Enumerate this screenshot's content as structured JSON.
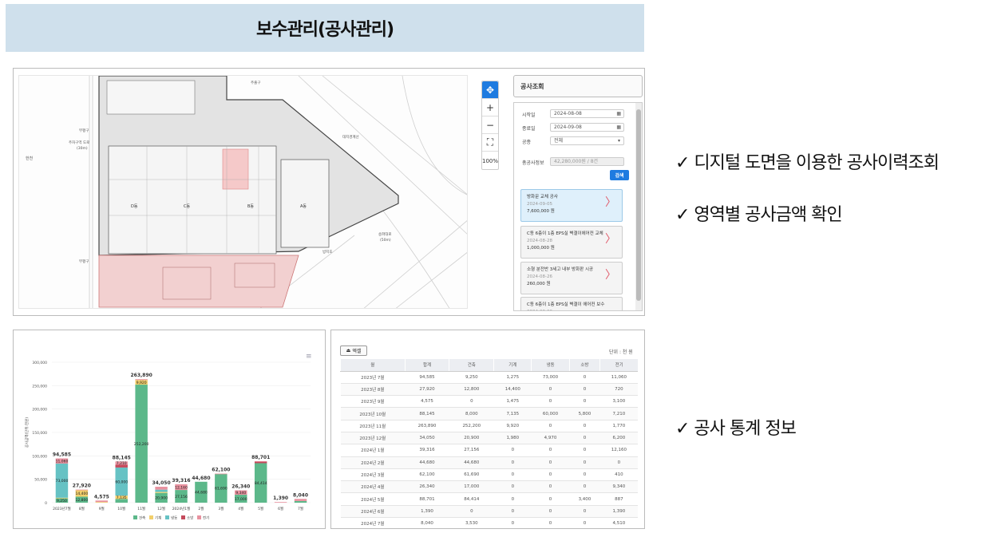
{
  "header": {
    "title": "보수관리(공사관리)"
  },
  "notes": [
    "✓ 디지털 도면을 이용한 공사이력조회",
    "✓ 영역별 공사금액 확인",
    "✓ 공사 통계 정보"
  ],
  "map": {
    "zoom_in": "+",
    "zoom_out": "−",
    "fullscreen": "⛶",
    "zoom_level": "100%",
    "labels": {
      "west_road": "한천",
      "bridge": "부평구",
      "note": "주차구역 도로",
      "note2": "(30m)",
      "east": "대지경계선",
      "south": "방지호",
      "road": "송파대로",
      "road2": "(50m)",
      "gate": "부평구",
      "top": "주출구"
    },
    "zones": [
      "D동",
      "C동",
      "B동",
      "A동"
    ]
  },
  "panel": {
    "title": "공사조회",
    "start_label": "시작일",
    "start_value": "2024-08-08",
    "end_label": "종료일",
    "end_value": "2024-09-08",
    "type_label": "공종",
    "type_value": "전체",
    "total_label": "총공사정보",
    "total_value": "42,280,000원 / 8건",
    "search_label": "검색",
    "cards": [
      {
        "title": "방화문 교체 공사",
        "date": "2024-09-05",
        "amount": "7,600,000 원"
      },
      {
        "title": "C동 6층이 1층 EPS실 벽결이에어컨 교체",
        "date": "2024-08-28",
        "amount": "1,000,000 원"
      },
      {
        "title": "소형 분전반 3세고 내부 방화판 시공",
        "date": "2024-08-26",
        "amount": "260,000 원"
      },
      {
        "title": "C동 6층이 1층 EPS실 벽결이 에어컨 보수",
        "date": "2024-08-20",
        "amount": ""
      }
    ]
  },
  "chart_data": {
    "type": "bar",
    "stacked": true,
    "ylabel": "공사금액(단위:천원)",
    "ylim": [
      0,
      300000
    ],
    "yticks": [
      "0",
      "50,000",
      "100,000",
      "150,000",
      "200,000",
      "250,000",
      "300,000"
    ],
    "categories": [
      "2023년7월",
      "8월",
      "9월",
      "10월",
      "11월",
      "12월",
      "2024년1월",
      "2월",
      "3월",
      "4월",
      "5월",
      "6월",
      "7월"
    ],
    "totals": [
      94585,
      27920,
      4575,
      88145,
      263890,
      34050,
      39316,
      44680,
      62100,
      26340,
      88701,
      1390,
      8040
    ],
    "total_labels": [
      "94,585",
      "27,920",
      "4,575",
      "88,145",
      "263,890",
      "34,050",
      "39,316",
      "44,680",
      "62,100",
      "26,340",
      "88,701",
      "1,390",
      "8,040"
    ],
    "series": [
      {
        "name": "건축",
        "color": "#5cb88a",
        "values": [
          9250,
          12800,
          0,
          8000,
          252200,
          20900,
          27156,
          44680,
          61690,
          17000,
          84414,
          0,
          3530
        ]
      },
      {
        "name": "기계",
        "color": "#f2cf6b",
        "values": [
          1275,
          14400,
          1475,
          7135,
          9920,
          1980,
          0,
          0,
          0,
          0,
          0,
          0,
          0
        ]
      },
      {
        "name": "냉동",
        "color": "#66c2c4",
        "values": [
          73000,
          0,
          0,
          60000,
          0,
          4970,
          0,
          0,
          0,
          0,
          0,
          0,
          0
        ]
      },
      {
        "name": "소방",
        "color": "#c44a5c",
        "values": [
          0,
          0,
          0,
          5800,
          0,
          0,
          0,
          0,
          0,
          0,
          3400,
          0,
          0
        ]
      },
      {
        "name": "전기",
        "color": "#e8919f",
        "values": [
          11060,
          720,
          3100,
          7210,
          1770,
          6200,
          12160,
          0,
          410,
          9340,
          887,
          1390,
          4510
        ]
      }
    ],
    "segment_labels": [
      {
        "i": 0,
        "text": "11,060"
      },
      {
        "i": 0,
        "text": "73,000"
      },
      {
        "i": 0,
        "text": "9,250"
      },
      {
        "i": 1,
        "text": "14,400"
      },
      {
        "i": 1,
        "text": "12,800"
      },
      {
        "i": 3,
        "text": "7,210"
      },
      {
        "i": 3,
        "text": "60,000"
      },
      {
        "i": 3,
        "text": "7,135"
      },
      {
        "i": 4,
        "text": "9,920"
      },
      {
        "i": 4,
        "text": "252,200"
      },
      {
        "i": 5,
        "text": "20,900"
      },
      {
        "i": 6,
        "text": "12,160"
      },
      {
        "i": 6,
        "text": "27,156"
      },
      {
        "i": 7,
        "text": "44,680"
      },
      {
        "i": 8,
        "text": "61,690"
      },
      {
        "i": 9,
        "text": "9,340"
      },
      {
        "i": 9,
        "text": "17,000"
      },
      {
        "i": 10,
        "text": "84,414"
      }
    ],
    "legend_position": "bottom"
  },
  "table": {
    "excel_label": "엑셀",
    "unit": "단위 : 천 원",
    "headers": [
      "월",
      "합계",
      "건축",
      "기계",
      "냉동",
      "소방",
      "전기"
    ],
    "rows": [
      [
        "2023년 7월",
        "94,585",
        "9,250",
        "1,275",
        "73,000",
        "0",
        "11,060"
      ],
      [
        "2023년 8월",
        "27,920",
        "12,800",
        "14,400",
        "0",
        "0",
        "720"
      ],
      [
        "2023년 9월",
        "4,575",
        "0",
        "1,475",
        "0",
        "0",
        "3,100"
      ],
      [
        "2023년 10월",
        "88,145",
        "8,000",
        "7,135",
        "60,000",
        "5,800",
        "7,210"
      ],
      [
        "2023년 11월",
        "263,890",
        "252,200",
        "9,920",
        "0",
        "0",
        "1,770"
      ],
      [
        "2023년 12월",
        "34,050",
        "20,900",
        "1,980",
        "4,970",
        "0",
        "6,200"
      ],
      [
        "2024년 1월",
        "39,316",
        "27,156",
        "0",
        "0",
        "0",
        "12,160"
      ],
      [
        "2024년 2월",
        "44,680",
        "44,680",
        "0",
        "0",
        "0",
        "0"
      ],
      [
        "2024년 3월",
        "62,100",
        "61,690",
        "0",
        "0",
        "0",
        "410"
      ],
      [
        "2024년 4월",
        "26,340",
        "17,000",
        "0",
        "0",
        "0",
        "9,340"
      ],
      [
        "2024년 5월",
        "88,701",
        "84,414",
        "0",
        "0",
        "3,400",
        "887"
      ],
      [
        "2024년 6월",
        "1,390",
        "0",
        "0",
        "0",
        "0",
        "1,390"
      ],
      [
        "2024년 7월",
        "8,040",
        "3,530",
        "0",
        "0",
        "0",
        "4,510"
      ]
    ]
  }
}
